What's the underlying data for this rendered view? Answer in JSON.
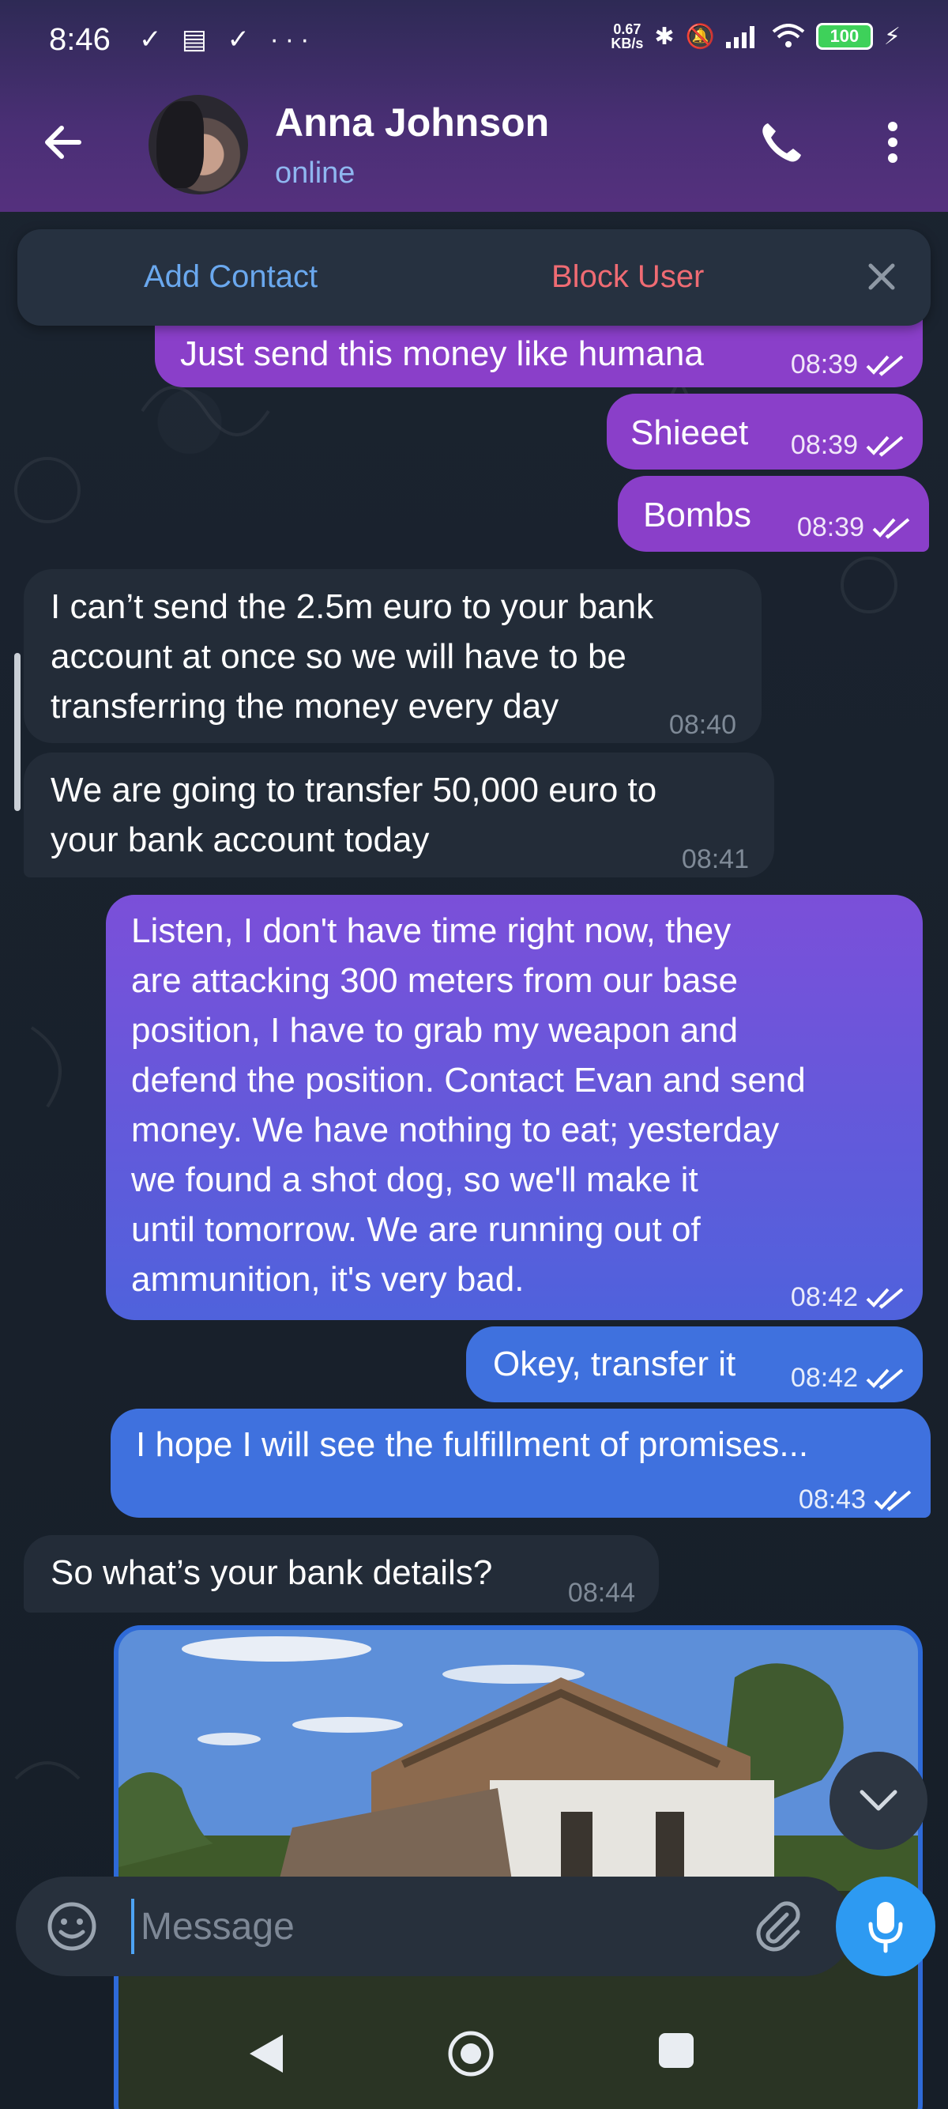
{
  "status_bar": {
    "time": "8:46",
    "left_icons": "✓ ▤ ✓ ···",
    "net_speed_top": "0.67",
    "net_speed_bottom": "KB/s",
    "battery": "100"
  },
  "header": {
    "contact_name": "Anna Johnson",
    "contact_status": "online"
  },
  "action_bar": {
    "add_contact": "Add Contact",
    "block_user": "Block User"
  },
  "messages": [
    {
      "dir": "out",
      "text": "Just send this money like humana",
      "time": "08:39"
    },
    {
      "dir": "out",
      "text": "Shieeet",
      "time": "08:39"
    },
    {
      "dir": "out",
      "text": "Bombs",
      "time": "08:39"
    },
    {
      "dir": "in",
      "lines": [
        "I can’t send the 2.5m euro to your bank",
        "account at once so we will have to be",
        "transferring the money every day"
      ],
      "time": "08:40"
    },
    {
      "dir": "in",
      "lines": [
        "We are going to transfer 50,000 euro to",
        "your bank account today"
      ],
      "time": "08:41"
    },
    {
      "dir": "out",
      "lines": [
        "Listen, I don't have time right now, they",
        "are attacking 300 meters from our base",
        "position, I have to grab my weapon and",
        "defend the position. Contact Evan and send",
        "money. We have nothing to eat; yesterday",
        "we found a shot dog, so we'll make it",
        "until tomorrow. We are running out of",
        "ammunition, it's very bad."
      ],
      "time": "08:42"
    },
    {
      "dir": "out",
      "text": "Okey, transfer it",
      "time": "08:42"
    },
    {
      "dir": "out",
      "text": "I hope I will see the fulfillment of promises...",
      "time": "08:43"
    },
    {
      "dir": "in",
      "text": "So what’s your bank details?",
      "time": "08:44"
    }
  ],
  "input": {
    "placeholder": "Message"
  },
  "icons": [
    "back-arrow-icon",
    "phone-icon",
    "more-vert-icon",
    "close-icon",
    "double-check-icon",
    "chevron-down-icon",
    "emoji-icon",
    "paperclip-icon",
    "microphone-icon",
    "nav-back-icon",
    "nav-home-icon",
    "nav-recent-icon"
  ],
  "colors": {
    "header": "#4a2f75",
    "outgoing_purple": "#8a3fc9",
    "outgoing_blue": "#3f71de",
    "incoming": "#232c38",
    "accent_blue": "#2d9af2",
    "block_red": "#ef6b73",
    "add_blue": "#6aa8ee"
  }
}
